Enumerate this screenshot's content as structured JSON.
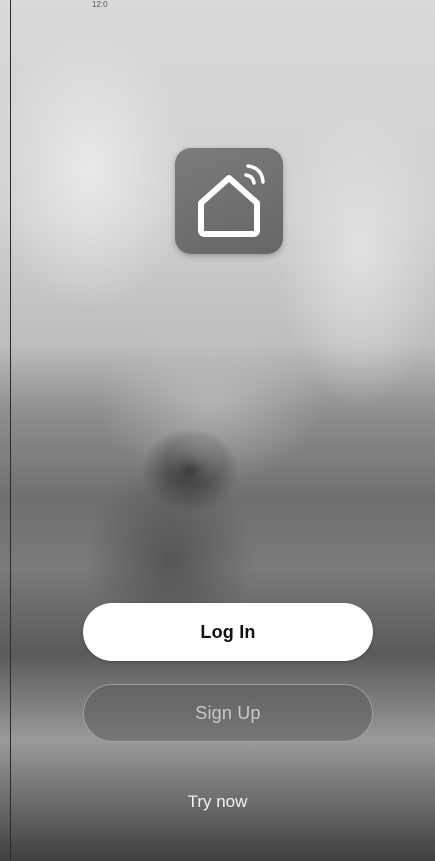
{
  "status_bar": {
    "time": "12:0"
  },
  "app_icon": {
    "icon": "smart-home-wifi-icon"
  },
  "actions": {
    "login_label": "Log In",
    "signup_label": "Sign Up",
    "try_now_label": "Try now"
  },
  "colors": {
    "login_bg": "#ffffff",
    "login_text": "#111111",
    "signup_bg": "#5a5a5a",
    "signup_text": "#c8c8c8",
    "icon_bg": "#707070"
  }
}
